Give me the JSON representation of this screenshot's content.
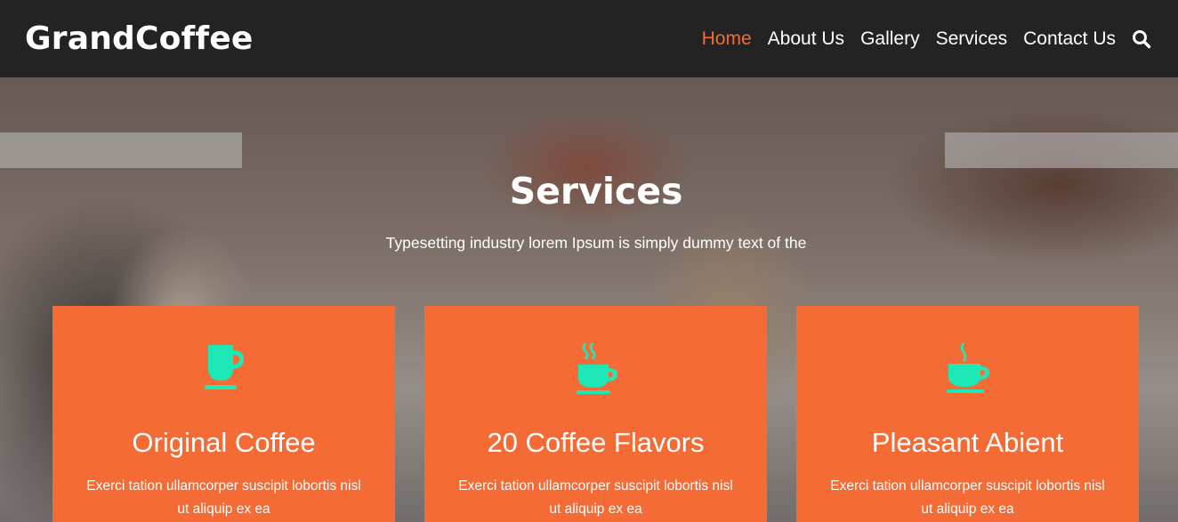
{
  "header": {
    "logo": "GrandCoffee",
    "nav": [
      {
        "label": "Home",
        "active": true
      },
      {
        "label": "About Us"
      },
      {
        "label": "Gallery"
      },
      {
        "label": "Services"
      },
      {
        "label": "Contact Us"
      }
    ],
    "search_icon": "search-icon"
  },
  "hero": {
    "title": "Services",
    "subtitle": "Typesetting industry lorem Ipsum is simply dummy text of the"
  },
  "services": [
    {
      "icon": "coffee-cup-icon",
      "title": "Original Coffee",
      "text": "Exerci tation ullamcorper suscipit lobortis nisl ut aliquip ex ea"
    },
    {
      "icon": "hot-coffee-icon",
      "title": "20 Coffee Flavors",
      "text": "Exerci tation ullamcorper suscipit lobortis nisl ut aliquip ex ea"
    },
    {
      "icon": "steaming-cup-icon",
      "title": "Pleasant Abient",
      "text": "Exerci tation ullamcorper suscipit lobortis nisl ut aliquip ex ea"
    }
  ],
  "colors": {
    "accent": "#f46b35",
    "icon": "#1de9b6",
    "header_bg": "#232323"
  }
}
